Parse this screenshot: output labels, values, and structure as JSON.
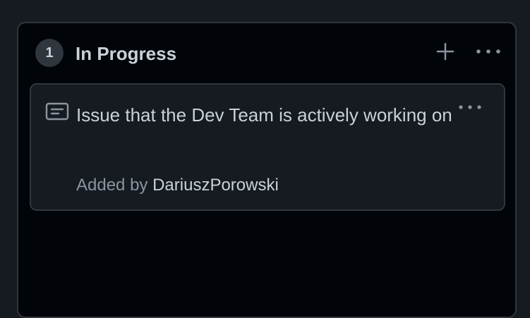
{
  "column": {
    "count": "1",
    "title": "In Progress",
    "add_icon": "plus-icon",
    "more_icon": "kebab-horizontal-icon"
  },
  "card": {
    "icon": "draft-issue-icon",
    "title": "Issue that the Dev Team is actively working on",
    "more_icon": "kebab-horizontal-icon",
    "added_by_label": "Added by",
    "author": "DariuszPorowski"
  },
  "colors": {
    "background": "#161b22",
    "column_background": "#010409",
    "border": "#30363d",
    "text_primary": "#c9d1d9",
    "text_muted": "#8b949e"
  }
}
